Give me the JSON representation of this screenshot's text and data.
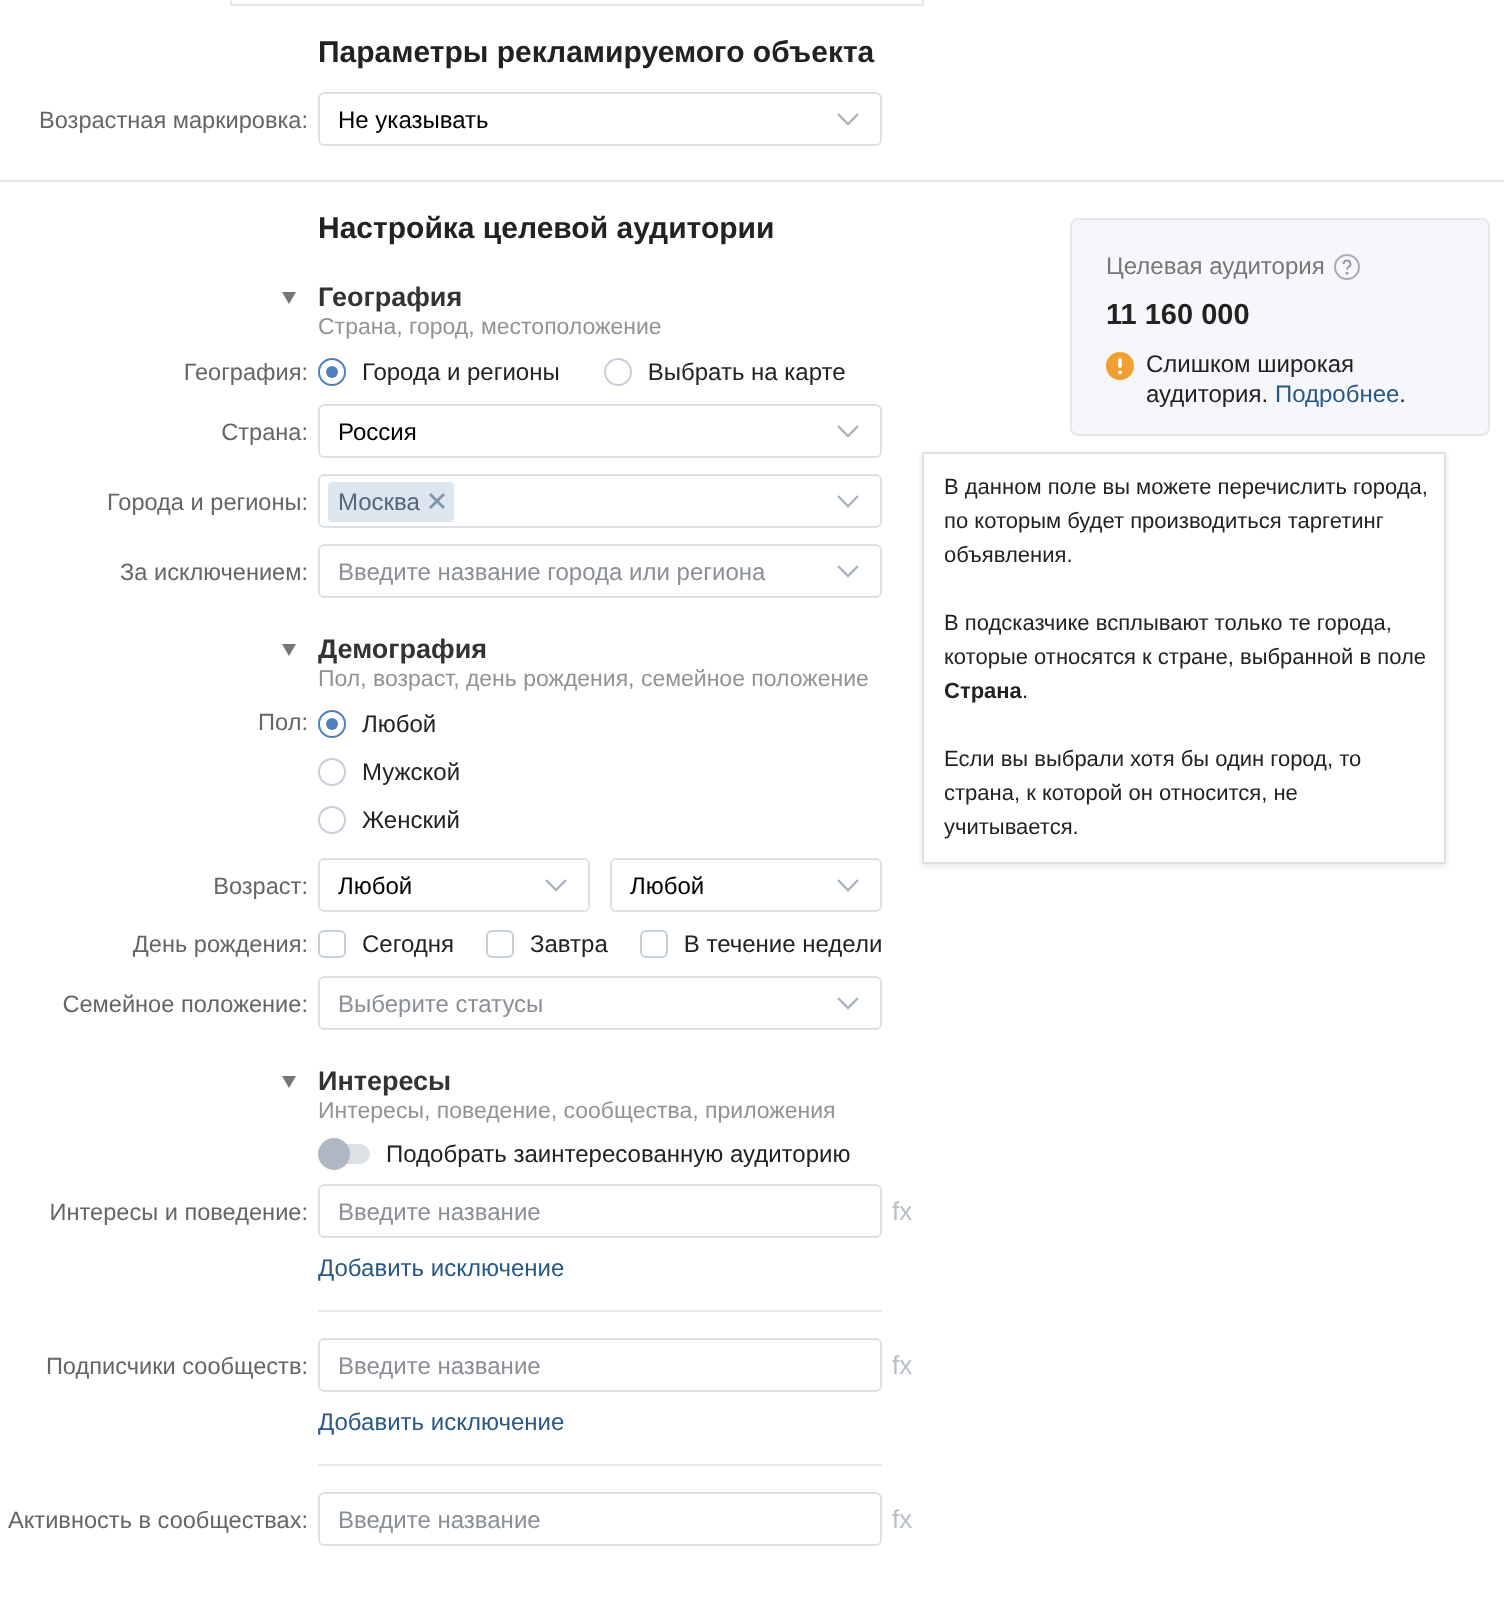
{
  "object_section": {
    "title": "Параметры рекламируемого объекта",
    "rows": [
      {
        "kind": "select",
        "label": "Возрастная маркировка:",
        "value": "Не указывать"
      }
    ]
  },
  "audience_section": {
    "title": "Настройка целевой аудитории",
    "groups": [
      {
        "heading": "География",
        "subtitle": "Страна, город, местоположение",
        "expanded": true,
        "rows": [
          {
            "kind": "radio_inline",
            "label": "География:",
            "options": [
              {
                "label": "Города и регионы",
                "selected": true
              },
              {
                "label": "Выбрать на карте",
                "selected": false
              }
            ]
          },
          {
            "kind": "select",
            "label": "Страна:",
            "value": "Россия"
          },
          {
            "kind": "tags",
            "label": "Города и регионы:",
            "tags": [
              "Москва"
            ]
          },
          {
            "kind": "select",
            "label": "За исключением:",
            "placeholder": "Введите название города или региона"
          }
        ]
      },
      {
        "heading": "Демография",
        "subtitle": "Пол, возраст, день рождения, семейное положение",
        "expanded": true,
        "rows": [
          {
            "kind": "radio_stack",
            "label": "Пол:",
            "options": [
              {
                "label": "Любой",
                "selected": true
              },
              {
                "label": "Мужской",
                "selected": false
              },
              {
                "label": "Женский",
                "selected": false
              }
            ]
          },
          {
            "kind": "select_pair",
            "label": "Возраст:",
            "values": [
              "Любой",
              "Любой"
            ]
          },
          {
            "kind": "checkboxes",
            "label": "День рождения:",
            "options": [
              {
                "label": "Сегодня",
                "checked": false
              },
              {
                "label": "Завтра",
                "checked": false
              },
              {
                "label": "В течение недели",
                "checked": false
              }
            ]
          },
          {
            "kind": "select",
            "label": "Семейное положение:",
            "placeholder": "Выберите статусы"
          }
        ]
      },
      {
        "heading": "Интересы",
        "subtitle": "Интересы, поведение, сообщества, приложения",
        "expanded": true,
        "rows": [
          {
            "kind": "toggle",
            "text": "Подобрать заинтересованную аудиторию",
            "on": false
          },
          {
            "kind": "input",
            "label": "Интересы и поведение:",
            "placeholder": "Введите название",
            "side": "fx",
            "link": "Добавить исключение"
          },
          {
            "kind": "input",
            "label": "Подписчики сообществ:",
            "placeholder": "Введите название",
            "side": "fx",
            "link": "Добавить исключение"
          },
          {
            "kind": "input",
            "label": "Активность в сообществах:",
            "placeholder": "Введите название",
            "side": "fx"
          }
        ]
      }
    ]
  },
  "audience_card": {
    "title": "Целевая аудитория",
    "count": "11 160 000",
    "warning": "Слишком широкая аудитория.",
    "link": "Подробнее",
    "after_link": "."
  },
  "tooltip": {
    "paragraphs": [
      "В данном поле вы можете перечислить города, по которым будет производиться таргетинг объявления.",
      "В подсказчике всплывают только те города, которые относятся к стране, выбранной в поле **Страна**.",
      "Если вы выбрали хотя бы один город, то страна, к которой он относится, не учитывается."
    ]
  }
}
